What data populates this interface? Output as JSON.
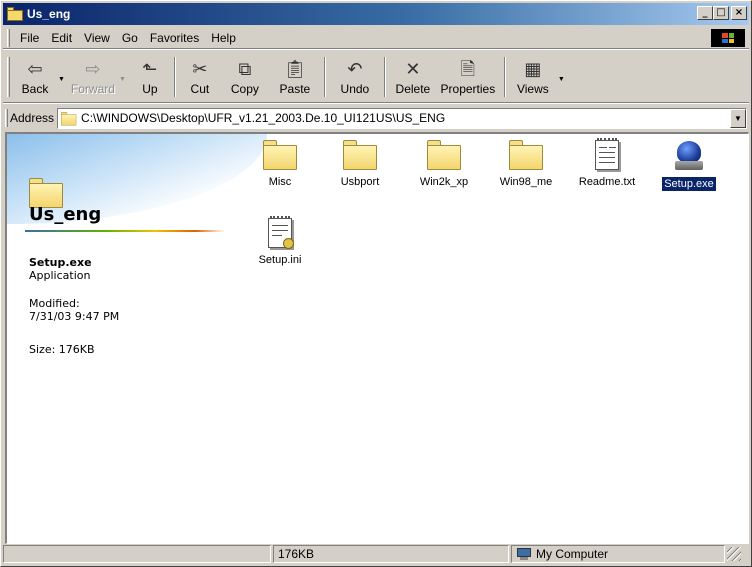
{
  "window": {
    "title": "Us_eng",
    "buttons": {
      "minimize": "_",
      "maximize": "□",
      "close": "×"
    }
  },
  "menu": [
    "File",
    "Edit",
    "View",
    "Go",
    "Favorites",
    "Help"
  ],
  "toolbar": {
    "back": "Back",
    "forward": "Forward",
    "up": "Up",
    "cut": "Cut",
    "copy": "Copy",
    "paste": "Paste",
    "undo": "Undo",
    "delete": "Delete",
    "properties": "Properties",
    "views": "Views"
  },
  "address": {
    "label": "Address",
    "value": "C:\\WINDOWS\\Desktop\\UFR_v1.21_2003.De.10_UI121US\\US_ENG"
  },
  "left_pane": {
    "folder_name": "Us_eng",
    "selected_name": "Setup.exe",
    "selected_type": "Application",
    "modified_label": "Modified:",
    "modified_value": "7/31/03 9:47 PM",
    "size_text": "Size: 176KB"
  },
  "files": [
    {
      "name": "Misc",
      "icon": "folder-icon",
      "selected": false
    },
    {
      "name": "Usbport",
      "icon": "folder-icon",
      "selected": false
    },
    {
      "name": "Win2k_xp",
      "icon": "folder-icon",
      "selected": false
    },
    {
      "name": "Win98_me",
      "icon": "folder-icon",
      "selected": false
    },
    {
      "name": "Readme.txt",
      "icon": "text-file-icon",
      "selected": false
    },
    {
      "name": "Setup.exe",
      "icon": "setup-application-icon",
      "selected": true
    },
    {
      "name": "Setup.ini",
      "icon": "ini-config-file-icon",
      "selected": false
    }
  ],
  "status": {
    "size": "176KB",
    "zone": "My Computer"
  }
}
